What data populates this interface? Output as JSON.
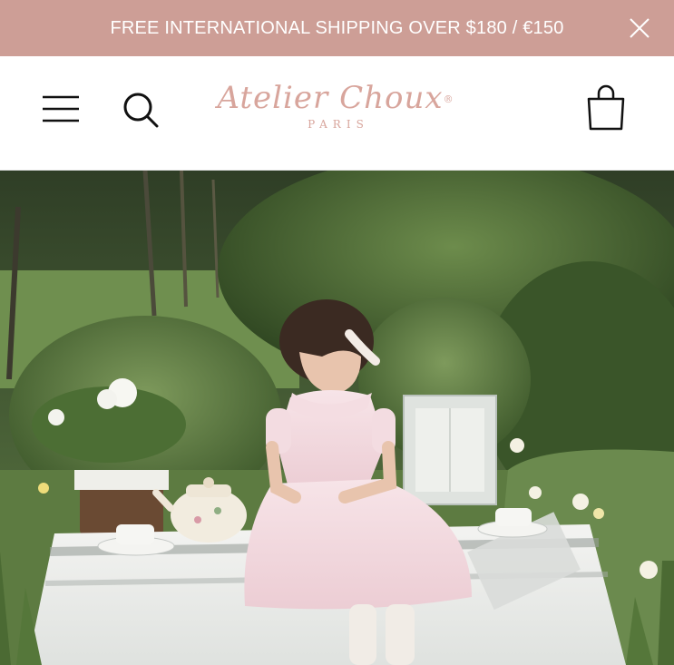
{
  "promo": {
    "text": "FREE INTERNATIONAL SHIPPING OVER $180 / €150",
    "close_icon": "close-icon"
  },
  "header": {
    "menu_icon": "hamburger-menu-icon",
    "search_icon": "search-icon",
    "cart_icon": "shopping-bag-icon",
    "logo": {
      "script": "Atelier Choux",
      "registered": "®",
      "sub": "PARIS"
    }
  },
  "colors": {
    "promo_bg": "#cd9e96",
    "logo": "#d8a59c",
    "icons": "#111111"
  }
}
